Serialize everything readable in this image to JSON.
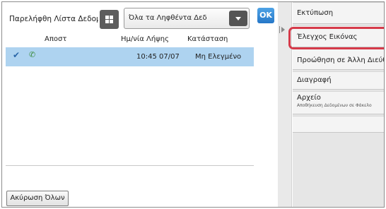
{
  "header": {
    "list_title": "Παρελήφθη Λίστα Δεδομ",
    "filter_value": "Όλα τα Ληφθέντα Δεδ",
    "ok_label": "OK"
  },
  "table": {
    "columns": [
      "Αποστ",
      "Ημ/νία Λήψης",
      "Κατάσταση"
    ],
    "rows": [
      {
        "sender": "",
        "received": "10:45 07/07",
        "status": "Μη Ελεγμένο",
        "selected": true
      }
    ]
  },
  "footer": {
    "cancel_all_label": "Ακύρωση Όλων"
  },
  "panel": {
    "items": [
      {
        "label": "Εκτύπωση"
      },
      {
        "label": "Έλεγχος Εικόνας"
      },
      {
        "label": "Προώθηση σε Άλλη Διεύθ"
      },
      {
        "label": "Διαγραφή"
      },
      {
        "label": "Αρχείο",
        "sublabel": "Αποθήκευση Δεδομένων σε Φάκελο"
      },
      {
        "label": ""
      }
    ]
  },
  "icons": {
    "check": "check-icon",
    "status": "received-status-icon",
    "grid": "grid-view-icon",
    "dropdown": "chevron-down-icon",
    "panel_toggle": "panel-collapse-icon"
  },
  "colors": {
    "selected_row": "#aed3f0",
    "ok_button": "#2e84d4",
    "highlight": "#d63a4a"
  }
}
